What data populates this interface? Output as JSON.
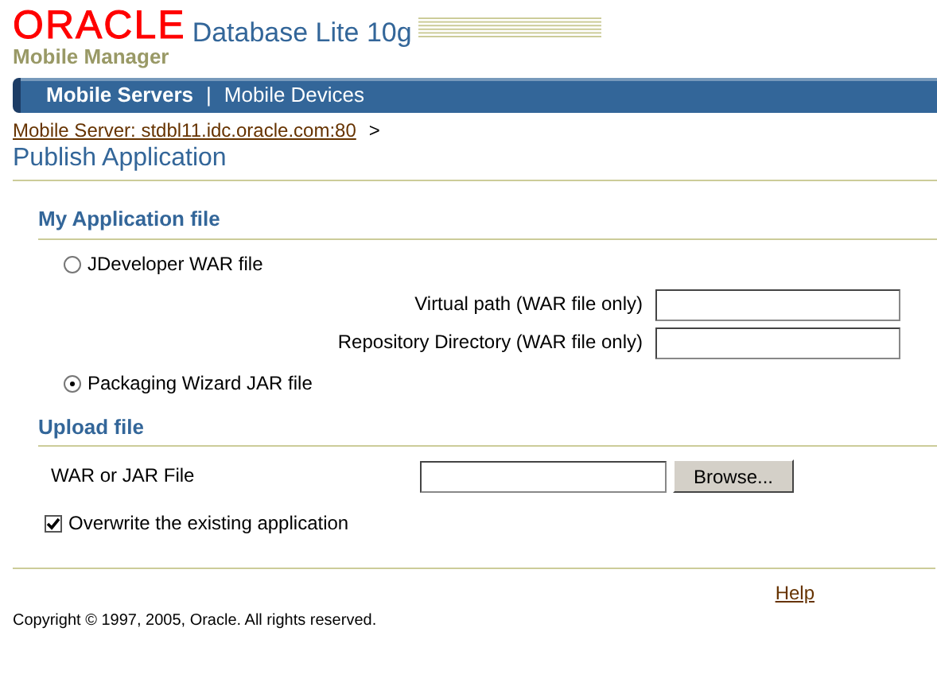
{
  "header": {
    "logo": "ORACLE",
    "product": "Database Lite 10g",
    "subtitle": "Mobile Manager"
  },
  "tabs": [
    {
      "label": "Mobile Servers",
      "selected": true
    },
    {
      "label": "Mobile Devices",
      "selected": false
    }
  ],
  "tab_separator": "|",
  "breadcrumb": {
    "link": "Mobile Server: stdbl11.idc.oracle.com:80",
    "separator": ">"
  },
  "page_title": "Publish Application",
  "sections": [
    {
      "title": "My Application file",
      "rows": [
        {
          "kind": "radio",
          "label": "JDeveloper WAR file",
          "selected": false
        },
        {
          "kind": "field",
          "label": "Virtual path (WAR file only)"
        },
        {
          "kind": "field",
          "label": "Repository Directory (WAR file only)"
        },
        {
          "kind": "radio",
          "label": "Packaging Wizard JAR file",
          "selected": true
        }
      ]
    },
    {
      "title": "Upload file",
      "rows": [
        {
          "kind": "file",
          "label": "WAR or JAR File",
          "button": "Browse..."
        },
        {
          "kind": "checkbox",
          "label": "Overwrite the existing application",
          "checked": true
        }
      ]
    }
  ],
  "footer": {
    "link": "Help",
    "copyright": "Copyright © 1997, 2005, Oracle. All rights reserved."
  }
}
